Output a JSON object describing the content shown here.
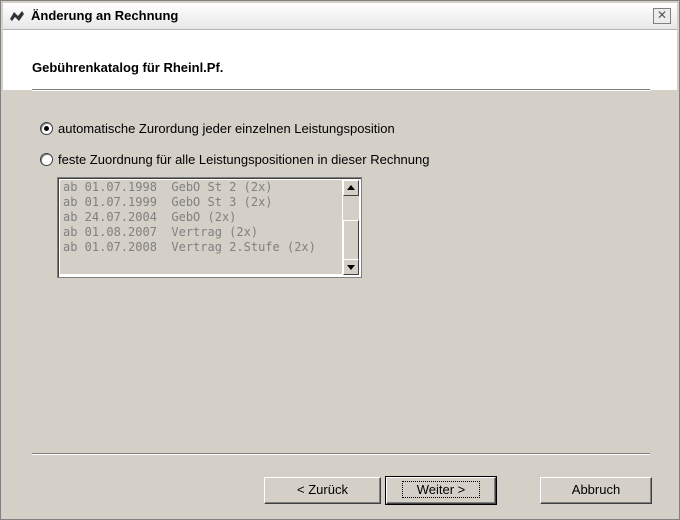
{
  "window": {
    "title": "Änderung an Rechnung",
    "close_label": "✕"
  },
  "header": {
    "title": "Gebührenkatalog für Rheinl.Pf."
  },
  "options": {
    "auto_label": "automatische Zurordung jeder einzelnen Leistungsposition",
    "fixed_label": "feste Zuordnung für alle Leistungspositionen in dieser Rechnung",
    "selected": "auto"
  },
  "catalog_list": {
    "items": [
      "ab 01.07.1998  GebO St 2 (2x)",
      "ab 01.07.1999  GebO St 3 (2x)",
      "ab 24.07.2004  GebO (2x)",
      "ab 01.08.2007  Vertrag (2x)",
      "ab 01.07.2008  Vertrag 2.Stufe (2x)"
    ]
  },
  "buttons": {
    "back_label": "< Zurück",
    "next_label": "Weiter >",
    "cancel_label": "Abbruch"
  }
}
